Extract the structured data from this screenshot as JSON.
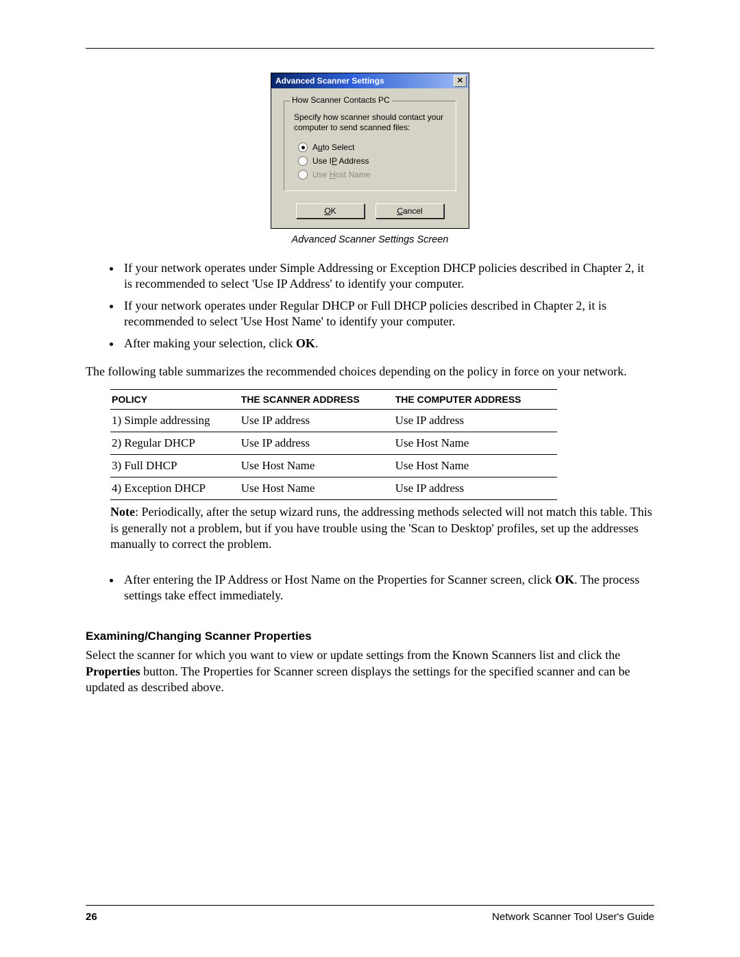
{
  "dialog": {
    "title": "Advanced Scanner Settings",
    "close_glyph": "✕",
    "group_legend": "How Scanner Contacts PC",
    "group_desc": "Specify how scanner should contact your computer to send scanned files:",
    "radio_auto_pre": "A",
    "radio_auto_u": "u",
    "radio_auto_post": "to Select",
    "radio_ip_pre": "Use I",
    "radio_ip_u": "P",
    "radio_ip_post": " Address",
    "radio_host_pre": "Use ",
    "radio_host_u": "H",
    "radio_host_post": "ost Name",
    "ok_u": "O",
    "ok_post": "K",
    "cancel_u": "C",
    "cancel_post": "ancel"
  },
  "caption": "Advanced Scanner Settings Screen",
  "bullets1": {
    "b1": "If your network operates under Simple Addressing or Exception DHCP policies described in Chapter 2, it is recommended to select 'Use IP Address' to identify your computer.",
    "b2": "If your network operates under Regular DHCP or Full DHCP policies described in Chapter 2, it is recommended to select 'Use Host Name' to identify your computer.",
    "b3_pre": "After making your selection, click ",
    "b3_bold": "OK",
    "b3_post": "."
  },
  "para_table_intro": "The following table summarizes the recommended choices depending on the policy in force on your network.",
  "table": {
    "h1": "POLICY",
    "h2": "THE SCANNER ADDRESS",
    "h3": "THE COMPUTER ADDRESS",
    "rows": [
      {
        "c1": "1) Simple addressing",
        "c2": "Use IP address",
        "c3": "Use IP address"
      },
      {
        "c1": "2) Regular DHCP",
        "c2": "Use IP address",
        "c3": "Use Host Name"
      },
      {
        "c1": "3) Full DHCP",
        "c2": "Use Host Name",
        "c3": "Use Host Name"
      },
      {
        "c1": "4) Exception DHCP",
        "c2": "Use Host Name",
        "c3": "Use IP address"
      }
    ]
  },
  "note_bold": "Note",
  "note_text": ": Periodically, after the setup wizard runs, the addressing methods selected will not match this table. This is generally not a problem, but if you have trouble using the 'Scan to Desktop' profiles, set up the addresses manually to correct the problem.",
  "bullet2_pre": "After entering the IP Address or Host Name on the Properties for Scanner screen, click ",
  "bullet2_bold": "OK",
  "bullet2_post": ". The process settings take effect immediately.",
  "section_heading": "Examining/Changing Scanner Properties",
  "section_text_pre": "Select the scanner for which you want to view or update settings from the Known Scanners list and click the ",
  "section_text_bold": "Properties",
  "section_text_post": " button. The Properties for Scanner screen displays the settings for the specified scanner and can be updated as described above.",
  "footer": {
    "page": "26",
    "guide": "Network Scanner Tool User's Guide"
  }
}
